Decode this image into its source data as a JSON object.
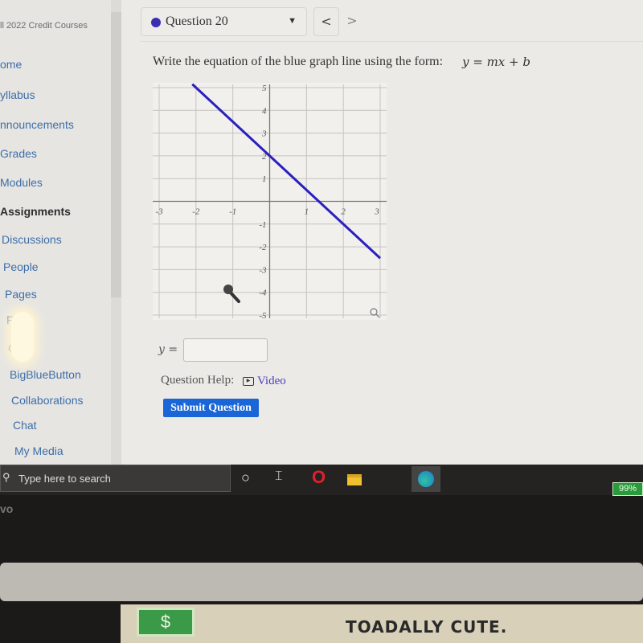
{
  "sidebar": {
    "course": "ll 2022 Credit Courses",
    "items": [
      {
        "label": "ome"
      },
      {
        "label": "yllabus"
      },
      {
        "label": "nnouncements"
      },
      {
        "label": "Grades"
      },
      {
        "label": "Modules"
      },
      {
        "label": "Assignments",
        "active": true
      },
      {
        "label": "Discussions"
      },
      {
        "label": "People"
      },
      {
        "label": "Pages"
      },
      {
        "label": "F"
      },
      {
        "label": "C    es"
      },
      {
        "label": "BigBlueButton"
      },
      {
        "label": "Collaborations"
      },
      {
        "label": "Chat"
      },
      {
        "label": "My Media"
      }
    ]
  },
  "question_nav": {
    "selected": "Question 20",
    "prev": "<",
    "next": ">",
    "dot_color": "#3a2fb0"
  },
  "question": {
    "prompt": "Write the equation of the blue graph line using the form:",
    "form": "y = mx + b",
    "answer_label": "y =",
    "answer_value": "",
    "help_label": "Question Help:",
    "video_label": "Video",
    "submit_label": "Submit Question"
  },
  "chart_data": {
    "type": "line",
    "xlim": [
      -3,
      3
    ],
    "ylim": [
      -5,
      5
    ],
    "x_ticks": [
      -3,
      -2,
      -1,
      1,
      2,
      3
    ],
    "y_ticks": [
      5,
      4,
      3,
      2,
      1,
      -1,
      -2,
      -3,
      -4,
      -5
    ],
    "grid": true,
    "line_color": "#2a1fc0",
    "series": [
      {
        "x": [
          -2.1,
          3
        ],
        "y": [
          5.15,
          -2.5
        ]
      }
    ]
  },
  "taskbar": {
    "search_placeholder": "Type here to search",
    "battery": "99%"
  },
  "bezel": {
    "logo": "vo",
    "sticker_text": "TOADALLY CUTE.",
    "bill": "$"
  }
}
